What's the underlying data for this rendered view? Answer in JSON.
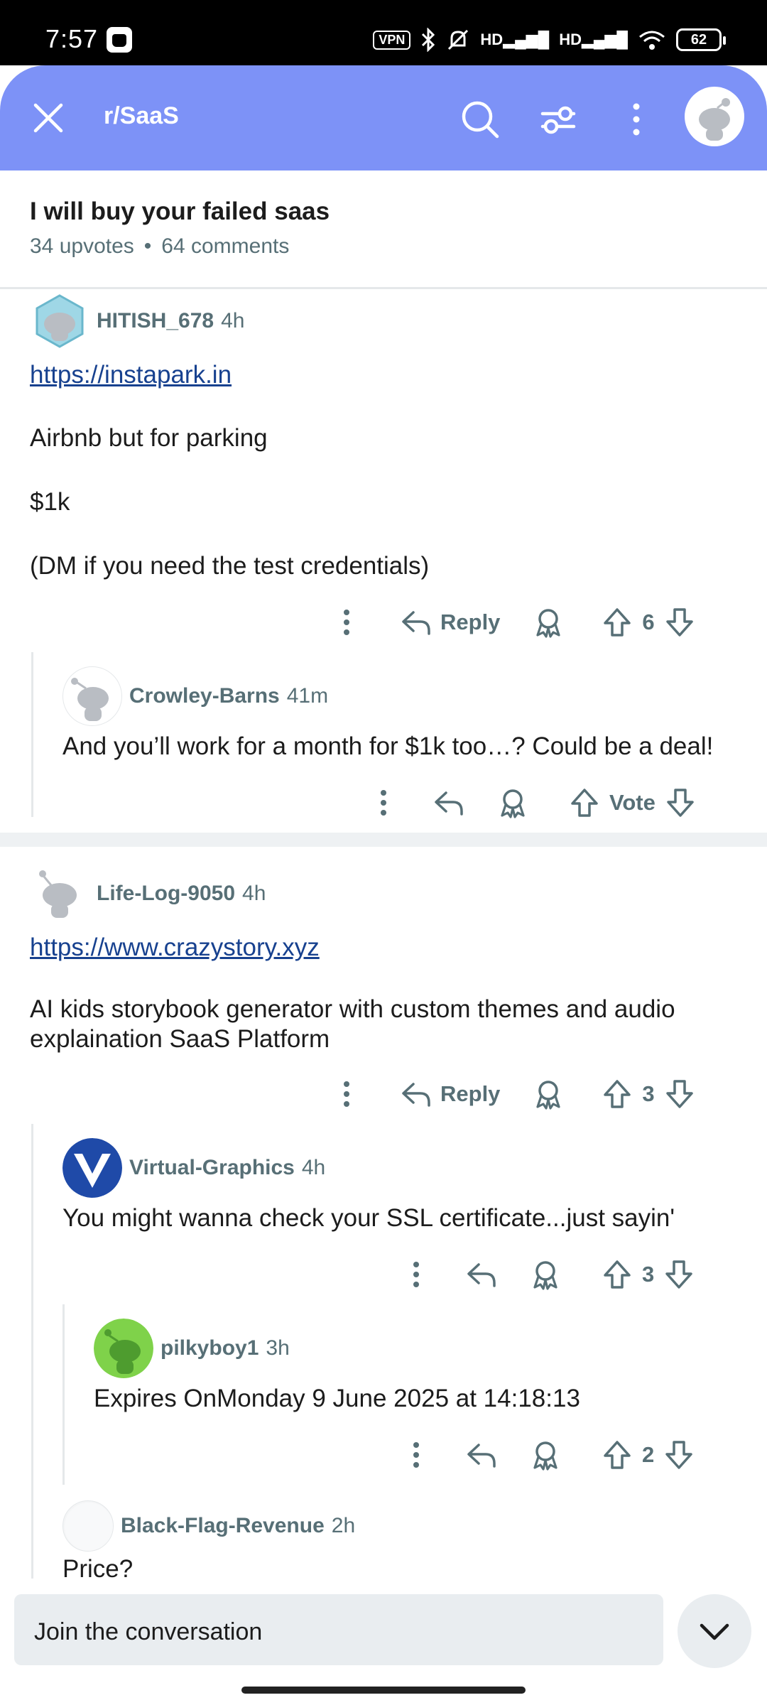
{
  "status_bar": {
    "time": "7:57",
    "vpn_label": "VPN",
    "network_1": "HD",
    "network_2": "HD",
    "battery": "62"
  },
  "header": {
    "subreddit": "r/SaaS",
    "background_color": "#7d92f7"
  },
  "post": {
    "title": "I will buy your failed saas",
    "upvotes": "34 upvotes",
    "separator": "•",
    "comments": "64 comments"
  },
  "comments": [
    {
      "user": "HITISH_678",
      "time": "4h",
      "link": "https://instapark.in",
      "paragraphs": [
        "Airbnb but for parking",
        "$1k",
        "(DM if you need the test credentials)"
      ],
      "reply_label": "Reply",
      "votes": "6",
      "avatar_icon": "snoo-hex-avatar-icon"
    },
    {
      "user": "Crowley-Barns",
      "time": "41m",
      "text": "And you’ll work for a month for $1k too…? Could be a deal!",
      "votes": "Vote",
      "avatar_icon": "snoo-avatar-icon"
    },
    {
      "user": "Life-Log-9050",
      "time": "4h",
      "link": "https://www.crazystory.xyz",
      "text": "AI kids storybook generator with custom themes and audio explaination SaaS Platform",
      "reply_label": "Reply",
      "votes": "3",
      "avatar_icon": "snoo-avatar-icon"
    },
    {
      "user": "Virtual-Graphics",
      "time": "4h",
      "text": "You might wanna check your SSL certificate...just sayin'",
      "votes": "3",
      "avatar_icon": "v-logo-avatar-icon"
    },
    {
      "user": "pilkyboy1",
      "time": "3h",
      "text": "Expires OnMonday 9 June 2025 at 14:18:13",
      "votes": "2",
      "avatar_icon": "green-snoo-avatar-icon"
    },
    {
      "user": "Black-Flag-Revenue",
      "time": "2h",
      "text": "Price?",
      "avatar_icon": "blank-avatar-icon"
    }
  ],
  "composer": {
    "placeholder": "Join the conversation"
  }
}
